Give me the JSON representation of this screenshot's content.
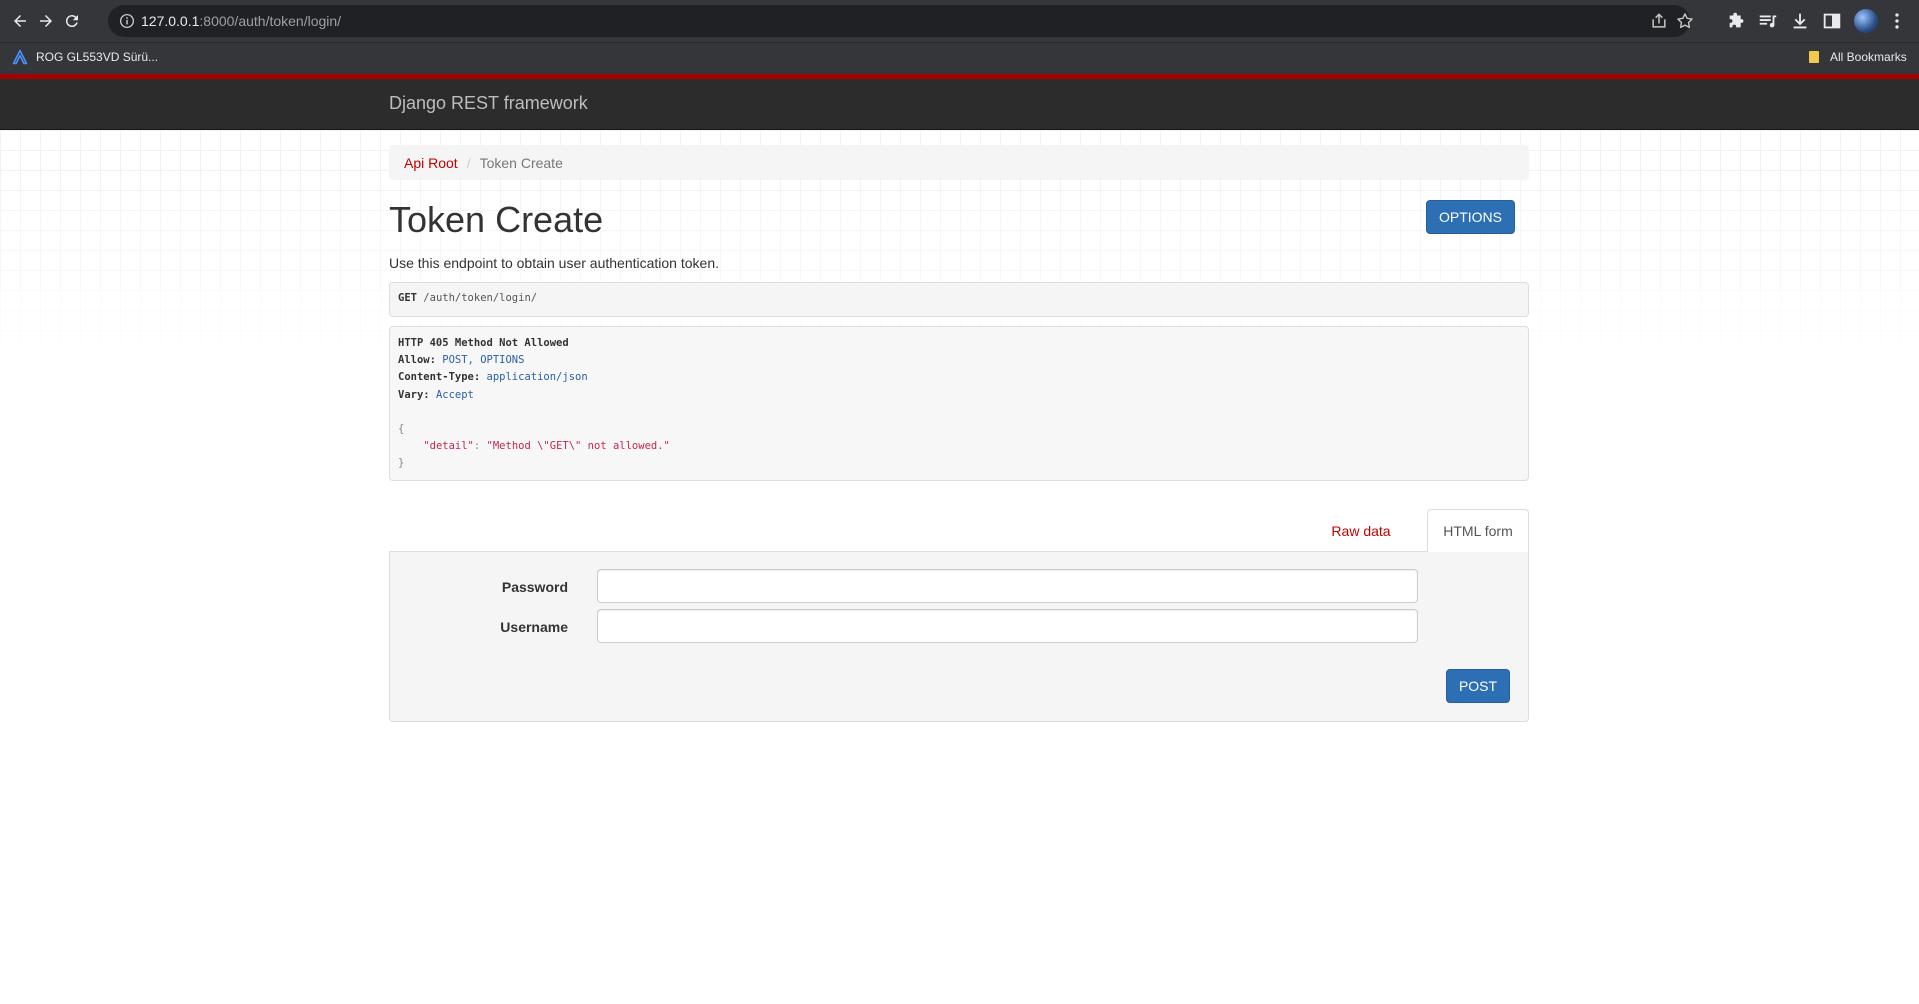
{
  "browser": {
    "url_host": "127.0.0.1",
    "url_rest": ":8000/auth/token/login/",
    "bookmark_left": "ROG GL553VD Sürü...",
    "bookmark_right": "All Bookmarks"
  },
  "navbar": {
    "brand": "Django REST framework"
  },
  "breadcrumb": {
    "root": "Api Root",
    "separator": "/",
    "current": "Token Create"
  },
  "page": {
    "title": "Token Create",
    "options_label": "OPTIONS",
    "description": "Use this endpoint to obtain user authentication token."
  },
  "request": {
    "method": "GET",
    "path": "/auth/token/login/"
  },
  "response": {
    "status": "HTTP 405 Method Not Allowed",
    "headers": [
      {
        "name": "Allow:",
        "value": "POST, OPTIONS"
      },
      {
        "name": "Content-Type:",
        "value": "application/json"
      },
      {
        "name": "Vary:",
        "value": "Accept"
      }
    ],
    "body_open": "{",
    "body_key": "\"detail\"",
    "body_colon": ": ",
    "body_value": "\"Method \\\"GET\\\" not allowed.\"",
    "body_close": "}"
  },
  "tabs": {
    "raw": "Raw data",
    "html": "HTML form"
  },
  "form": {
    "fields": [
      {
        "label": "Password",
        "value": ""
      },
      {
        "label": "Username",
        "value": ""
      }
    ],
    "submit_label": "POST"
  }
}
